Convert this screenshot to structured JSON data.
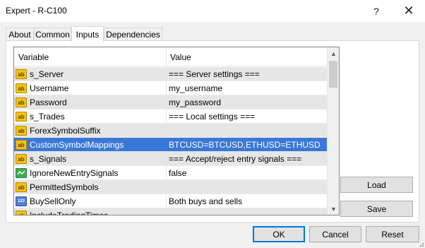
{
  "window": {
    "title": "Expert - R-C100",
    "help_glyph": "?",
    "close_glyph": "✕"
  },
  "tabs": [
    {
      "label": "About"
    },
    {
      "label": "Common"
    },
    {
      "label": "Inputs",
      "active": true
    },
    {
      "label": "Dependencies"
    }
  ],
  "table": {
    "columns": [
      "Variable",
      "Value"
    ],
    "rows": [
      {
        "icon": "ab-string-icon",
        "icon_text": "ab",
        "variable": "s_Server",
        "value": "=== Server settings ==="
      },
      {
        "icon": "ab-string-icon",
        "icon_text": "ab",
        "variable": "Username",
        "value": "my_username"
      },
      {
        "icon": "ab-string-icon",
        "icon_text": "ab",
        "variable": "Password",
        "value": "my_password"
      },
      {
        "icon": "ab-string-icon",
        "icon_text": "ab",
        "variable": "s_Trades",
        "value": "=== Local settings ==="
      },
      {
        "icon": "ab-string-icon",
        "icon_text": "ab",
        "variable": "ForexSymbolSuffix",
        "value": ""
      },
      {
        "icon": "ab-string-icon",
        "icon_text": "ab",
        "variable": "CustomSymbolMappings",
        "value": "BTCUSD=BTCUSD,ETHUSD=ETHUSD",
        "selected": true
      },
      {
        "icon": "ab-string-icon",
        "icon_text": "ab",
        "variable": "s_Signals",
        "value": "=== Accept/reject entry signals ==="
      },
      {
        "icon": "bool-icon",
        "icon_text": "",
        "variable": "IgnoreNewEntrySignals",
        "value": "false"
      },
      {
        "icon": "ab-string-icon",
        "icon_text": "ab",
        "variable": "PermittedSymbols",
        "value": ""
      },
      {
        "icon": "int-123-icon",
        "icon_text": "123",
        "variable": "BuySellOnly",
        "value": "Both buys and sells"
      },
      {
        "icon": "ab-string-icon",
        "icon_text": "ab",
        "variable": "IncludeTradingTimes",
        "value": ""
      }
    ]
  },
  "side_buttons": {
    "load": "Load",
    "save": "Save"
  },
  "footer_buttons": {
    "ok": "OK",
    "cancel": "Cancel",
    "reset": "Reset"
  },
  "colors": {
    "selection": "#3a78d8",
    "shaded_row": "#e6e6e6",
    "default_button_border": "#0078d7",
    "string_icon": "#f3c316",
    "int_icon": "#4f7fd6",
    "bool_icon": "#3fae53"
  }
}
